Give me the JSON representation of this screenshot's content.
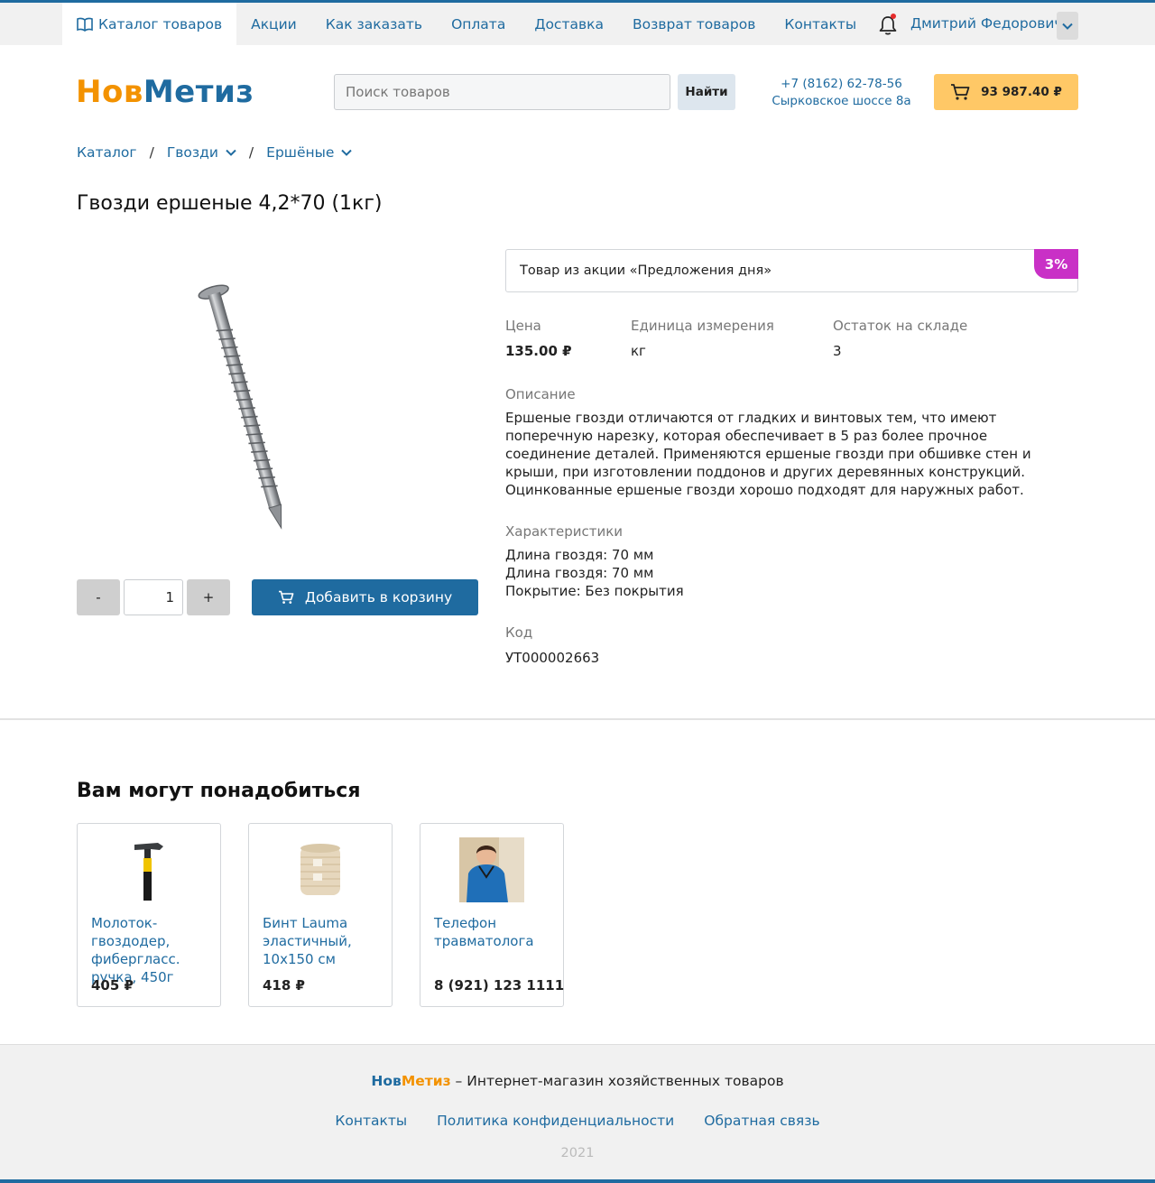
{
  "topnav": {
    "items": [
      {
        "label": "Каталог товаров",
        "icon": "book-icon"
      },
      {
        "label": "Акции"
      },
      {
        "label": "Как заказать"
      },
      {
        "label": "Оплата"
      },
      {
        "label": "Доставка"
      },
      {
        "label": "Возврат товаров"
      },
      {
        "label": "Контакты"
      }
    ],
    "user_name": "Дмитрий Федорович"
  },
  "header": {
    "logo_part1": "Нов",
    "logo_part2": "Метиз",
    "search_placeholder": "Поиск товаров",
    "search_button": "Найти",
    "phone": "+7 (8162) 62-78-56",
    "address": "Сырковское шоссе 8а",
    "cart_total": "93 987.40 ₽"
  },
  "breadcrumb": [
    "Каталог",
    "Гвозди",
    "Ершёные"
  ],
  "product": {
    "title": "Гвозди ершеные 4,2*70 (1кг)",
    "quantity": "1",
    "qty_minus": "-",
    "qty_plus": "+",
    "add_to_cart": "Добавить в корзину",
    "promo_text": "Товар из акции «Предложения дня»",
    "promo_badge": "3%",
    "price_label": "Цена",
    "price": "135.00 ₽",
    "unit_label": "Единица измерения",
    "unit": "кг",
    "stock_label": "Остаток на складе",
    "stock": "3",
    "description_label": "Описание",
    "description": "Ершеные гвозди отличаются от гладких и винтовых тем, что имеют поперечную нарезку, которая обеспечивает в 5 раз более прочное соединение деталей. Применяются ершеные гвозди при обшивке стен и крыши, при изготовлении поддонов и других деревянных конструкций. Оцинкованные ершеные гвозди хорошо подходят для наружных работ.",
    "specs_label": "Характеристики",
    "specs": [
      "Длина гвоздя: 70 мм",
      "Длина гвоздя: 70 мм",
      "Покрытие: Без покрытия"
    ],
    "code_label": "Код",
    "code": "УТ000002663"
  },
  "related": {
    "title": "Вам могут понадобиться",
    "items": [
      {
        "name": "Молоток-гвоздодер, фибергласс. ручка, 450г",
        "price": "405 ₽"
      },
      {
        "name": "Бинт Lauma эластичный, 10х150 см",
        "price": "418 ₽"
      },
      {
        "name": "Телефон травматолога",
        "price": "8 (921) 123 1111"
      }
    ]
  },
  "footer": {
    "logo_part1": "Нов",
    "logo_part2": "Метиз",
    "tagline": " – Интернет-магазин хозяйственных товаров",
    "links": [
      "Контакты",
      "Политика конфиденциальности",
      "Обратная связь"
    ],
    "year": "2021"
  },
  "colors": {
    "accent": "#1f6ba0",
    "brand_orange": "#f39200",
    "cart_button": "#ffc866",
    "badge": "#c930c6"
  }
}
